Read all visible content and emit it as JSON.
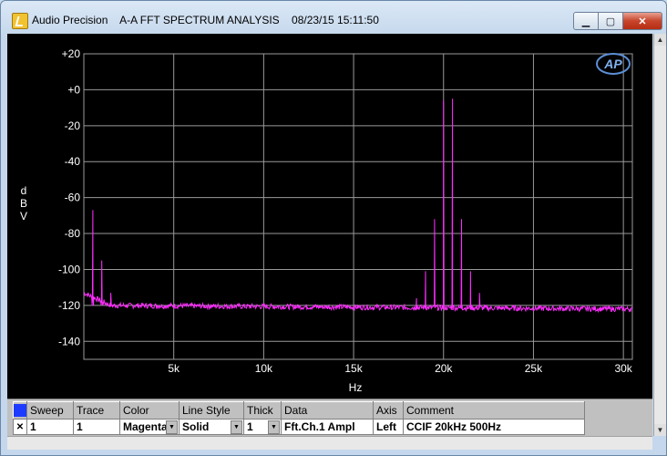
{
  "window": {
    "app_name": "Audio Precision",
    "document_title": "A-A FFT SPECTRUM ANALYSIS",
    "timestamp": "08/23/15 15:11:50",
    "minimize_label": "▁",
    "maximize_label": "▢",
    "close_label": "✕"
  },
  "graph": {
    "logo_text": "AP",
    "colors": {
      "background": "#000000",
      "grid": "#9a9a9a",
      "trace": "#ff2cff",
      "text": "#ffffff"
    }
  },
  "chart_data": {
    "type": "line",
    "xlabel": "Hz",
    "ylabel": "d B V",
    "xlim": [
      0,
      30500
    ],
    "ylim": [
      -150,
      20
    ],
    "x_ticks": [
      5000,
      10000,
      15000,
      20000,
      25000,
      30000
    ],
    "x_tick_labels": [
      "5k",
      "10k",
      "15k",
      "20k",
      "25k",
      "30k"
    ],
    "y_ticks": [
      20,
      0,
      -20,
      -40,
      -60,
      -80,
      -100,
      -120,
      -140
    ],
    "y_tick_labels": [
      "+20",
      "+0",
      "-20",
      "-40",
      "-60",
      "-80",
      "-100",
      "-120",
      "-140"
    ],
    "grid": true,
    "series": [
      {
        "noise_floor_start": -113,
        "noise_floor_mid": -120,
        "noise_floor_end": -122,
        "peaks": [
          {
            "x": 500,
            "y": -67
          },
          {
            "x": 1000,
            "y": -95
          },
          {
            "x": 1500,
            "y": -113
          },
          {
            "x": 18500,
            "y": -116
          },
          {
            "x": 19000,
            "y": -101
          },
          {
            "x": 19500,
            "y": -72
          },
          {
            "x": 20000,
            "y": -6
          },
          {
            "x": 20500,
            "y": -5
          },
          {
            "x": 21000,
            "y": -72
          },
          {
            "x": 21500,
            "y": -101
          },
          {
            "x": 22000,
            "y": -113
          }
        ]
      }
    ]
  },
  "sweep_panel": {
    "headers": [
      "Sweep",
      "Trace",
      "Color",
      "Line Style",
      "Thick",
      "Data",
      "Axis",
      "Comment"
    ],
    "row": {
      "checkbox": "✕",
      "sweep": "1",
      "trace": "1",
      "color": "Magenta",
      "line_style": "Solid",
      "thick": "1",
      "data": "Fft.Ch.1 Ampl",
      "axis": "Left",
      "comment": "CCIF 20kHz 500Hz"
    }
  }
}
